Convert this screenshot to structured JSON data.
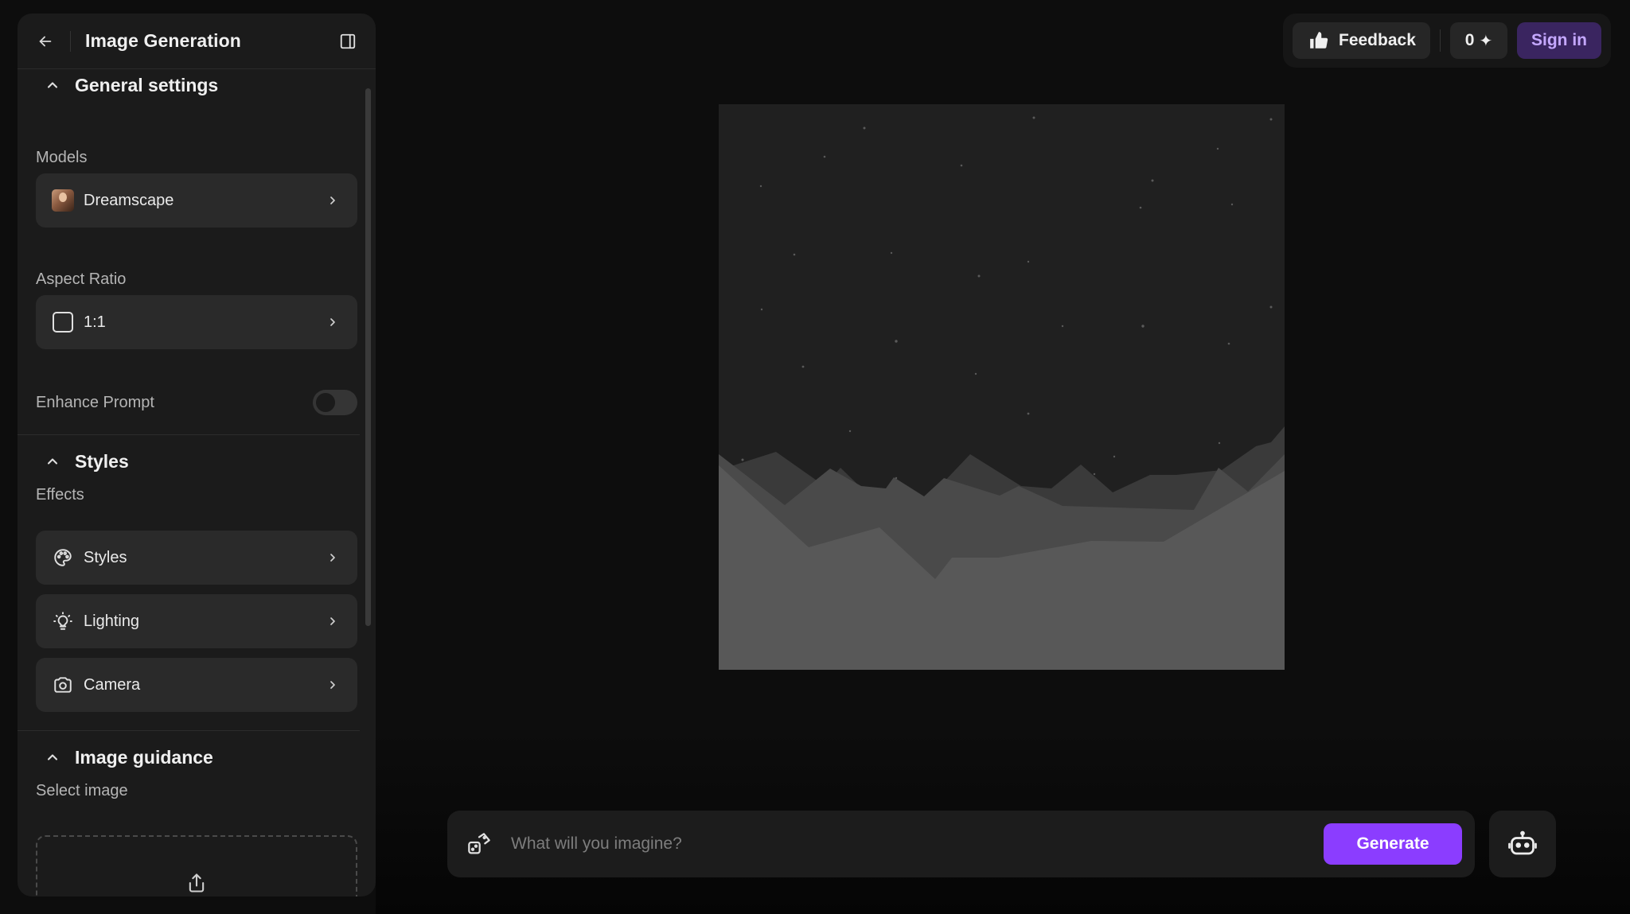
{
  "panel": {
    "title": "Image Generation",
    "general": {
      "heading": "General settings",
      "models_label": "Models",
      "model_value": "Dreamscape",
      "aspect_label": "Aspect Ratio",
      "aspect_value": "1:1",
      "enhance_label": "Enhance Prompt",
      "enhance_on": false
    },
    "styles": {
      "heading": "Styles",
      "effects_label": "Effects",
      "items": [
        {
          "label": "Styles",
          "icon": "palette-icon"
        },
        {
          "label": "Lighting",
          "icon": "lightbulb-icon"
        },
        {
          "label": "Camera",
          "icon": "camera-icon"
        }
      ]
    },
    "guidance": {
      "heading": "Image guidance",
      "select_label": "Select image"
    }
  },
  "topbar": {
    "feedback_label": "Feedback",
    "credits": "0",
    "signin_label": "Sign in"
  },
  "prompt": {
    "placeholder": "What will you imagine?",
    "generate_label": "Generate"
  },
  "colors": {
    "accent": "#8b3dff",
    "signin_bg": "#3a2560",
    "signin_text": "#c5a8ff",
    "background": "#0d0d0d",
    "panel": "#1b1b1b"
  }
}
